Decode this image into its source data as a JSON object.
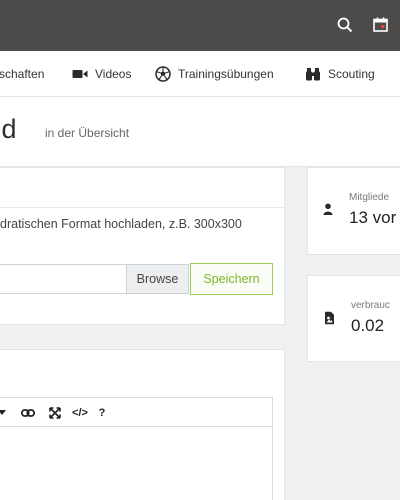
{
  "colors": {
    "topbar": "#4c4b49",
    "accent_green": "#7bb52a",
    "background": "#eef0f2"
  },
  "topbar": {
    "icons": [
      "search-icon",
      "calendar-icon"
    ]
  },
  "nav": {
    "items": [
      {
        "label": "schaften",
        "icon": ""
      },
      {
        "label": "Videos",
        "icon": "video-camera-icon"
      },
      {
        "label": "Trainingsübungen",
        "icon": "soccer-ball-icon"
      },
      {
        "label": "Scouting",
        "icon": "binoculars-icon"
      }
    ]
  },
  "header": {
    "title": "nd",
    "subtitle": "in der Übersicht"
  },
  "upload": {
    "hint": "dratischen Format hochladen, z.B. 300x300",
    "file_value": "",
    "browse_label": "Browse",
    "save_label": "Speichern"
  },
  "editor": {
    "toolbar": [
      "caret-down-icon",
      "link-icon",
      "fullscreen-icon",
      "code-icon",
      "help-icon"
    ],
    "help_label": "?",
    "code_label": "</>"
  },
  "stats": [
    {
      "label": "Mitgliede",
      "value": "13 vor",
      "icon": "user-icon"
    },
    {
      "label": "verbrauc",
      "value": "0.02",
      "icon": "file-icon"
    }
  ]
}
